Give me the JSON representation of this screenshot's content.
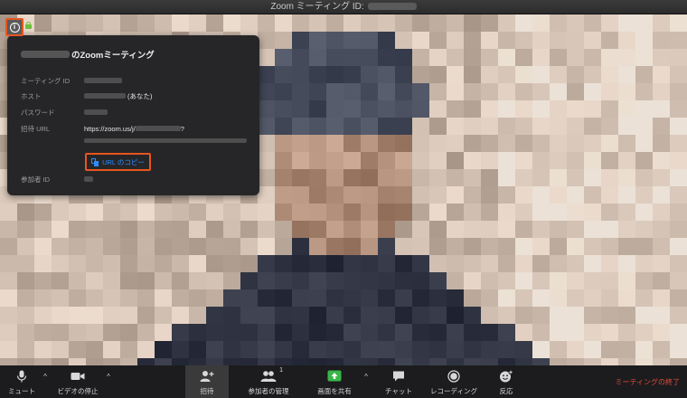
{
  "window": {
    "title": "Zoom ミーティング ID:"
  },
  "info_panel": {
    "title_suffix": "のZoomミーティング",
    "rows": {
      "meeting_id_label": "ミーティング ID",
      "host_label": "ホスト",
      "host_suffix": "(あなた)",
      "password_label": "パスワード",
      "invite_url_label": "招待 URL",
      "invite_url_prefix": "https://zoom.us/j/",
      "invite_url_suffix": "?",
      "participant_id_label": "参加者 ID"
    },
    "copy_url_label": "URL のコピー"
  },
  "toolbar": {
    "mute_label": "ミュート",
    "stop_video_label": "ビデオの停止",
    "invite_label": "招待",
    "participants_label": "参加者の管理",
    "participants_count": "1",
    "share_screen_label": "画面を共有",
    "chat_label": "チャット",
    "recording_label": "レコーディング",
    "reactions_label": "反応",
    "end_meeting_label": "ミーティングの終了"
  },
  "icons": {
    "info": "info-icon",
    "lock": "lock-icon",
    "copy": "copy-icon",
    "microphone": "microphone-icon",
    "video": "video-camera-icon",
    "invite": "add-person-icon",
    "participants": "participants-icon",
    "share": "share-screen-icon",
    "chat": "chat-bubble-icon",
    "record": "record-icon",
    "reactions": "emoji-add-icon"
  },
  "colors": {
    "highlight": "#e8551f",
    "link": "#2d8cff",
    "end_meeting": "#e24a3b",
    "share_green": "#39b54a",
    "lock_green": "#6bbf3a"
  }
}
